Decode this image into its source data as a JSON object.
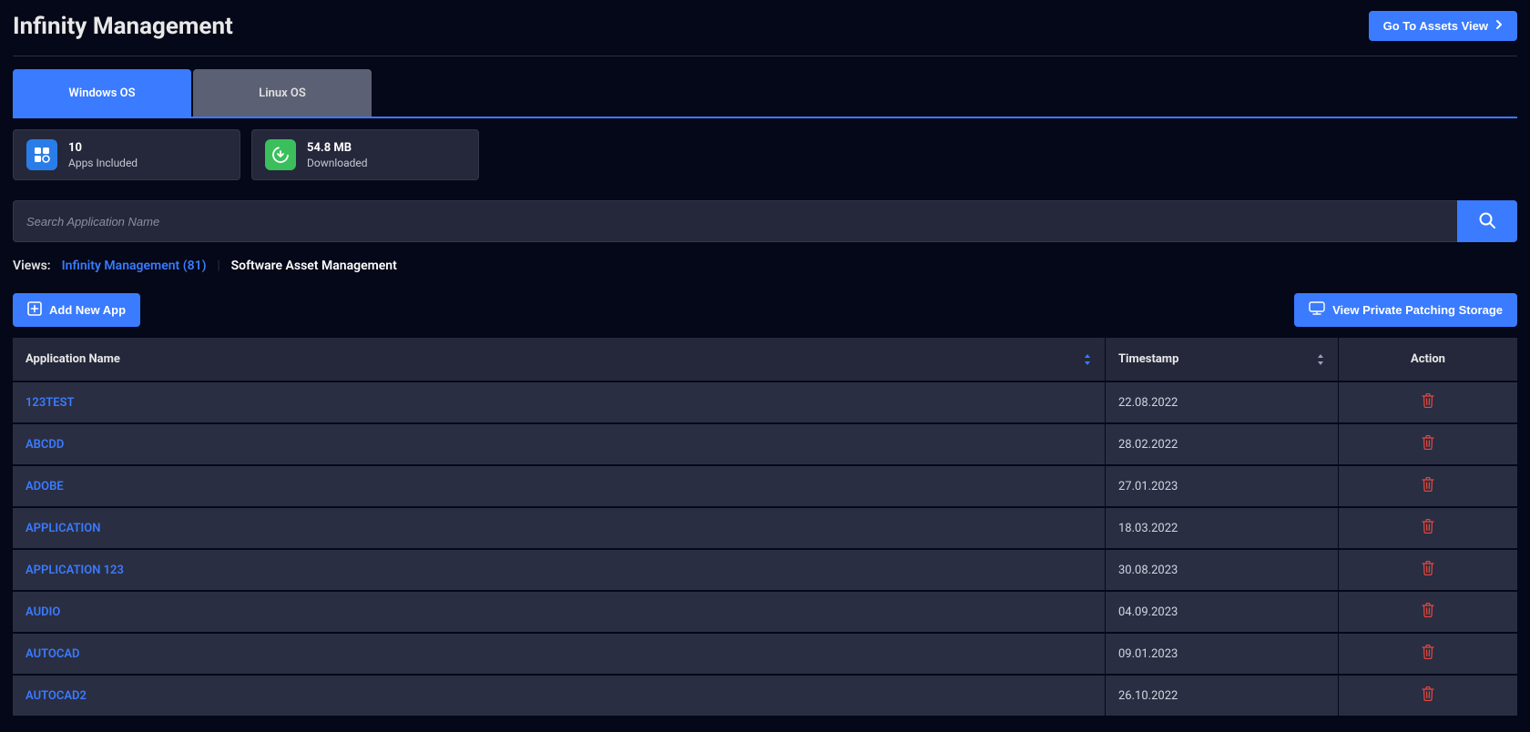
{
  "header": {
    "title": "Infinity Management",
    "assets_button": "Go To Assets View"
  },
  "tabs": [
    {
      "label": "Windows OS",
      "active": true
    },
    {
      "label": "Linux OS",
      "active": false
    }
  ],
  "stats": {
    "apps": {
      "value": "10",
      "label": "Apps Included"
    },
    "downloaded": {
      "value": "54.8 MB",
      "label": "Downloaded"
    }
  },
  "search": {
    "placeholder": "Search Application Name"
  },
  "views": {
    "label": "Views:",
    "active": "Infinity Management (81)",
    "other": "Software Asset Management"
  },
  "buttons": {
    "add_app": "Add New App",
    "view_storage": "View Private Patching Storage"
  },
  "table": {
    "headers": {
      "app_name": "Application Name",
      "timestamp": "Timestamp",
      "action": "Action"
    },
    "rows": [
      {
        "name": "123TEST",
        "ts": "22.08.2022"
      },
      {
        "name": "ABCDD",
        "ts": "28.02.2022"
      },
      {
        "name": "ADOBE",
        "ts": "27.01.2023"
      },
      {
        "name": "APPLICATION",
        "ts": "18.03.2022"
      },
      {
        "name": "APPLICATION 123",
        "ts": "30.08.2023"
      },
      {
        "name": "AUDIO",
        "ts": "04.09.2023"
      },
      {
        "name": "AUTOCAD",
        "ts": "09.01.2023"
      },
      {
        "name": "AUTOCAD2",
        "ts": "26.10.2022"
      }
    ]
  }
}
